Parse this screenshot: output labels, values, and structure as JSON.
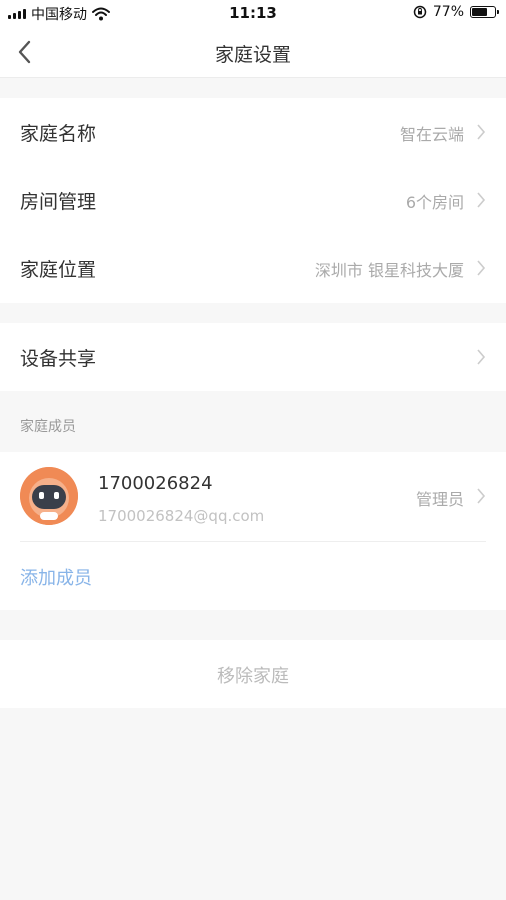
{
  "status_bar": {
    "carrier": "中国移动",
    "time": "11:13",
    "battery_percent": "77%",
    "battery_level": 0.77,
    "icons": [
      "signal-icon",
      "wifi-icon",
      "rotation-lock-icon",
      "battery-icon"
    ]
  },
  "nav": {
    "title": "家庭设置",
    "back_icon": "chevron-left-icon"
  },
  "settings": {
    "rows": [
      {
        "label": "家庭名称",
        "value": "智在云端"
      },
      {
        "label": "房间管理",
        "value": "6个房间"
      },
      {
        "label": "家庭位置",
        "value": "深圳市 银星科技大厦"
      }
    ],
    "share": {
      "label": "设备共享"
    }
  },
  "members": {
    "section_label": "家庭成员",
    "list": [
      {
        "name": "1700026824",
        "email": "1700026824@qq.com",
        "role": "管理员",
        "avatar_icon": "robot-avatar-icon"
      }
    ],
    "add_label": "添加成员"
  },
  "remove_label": "移除家庭",
  "colors": {
    "background": "#f7f7f7",
    "card": "#ffffff",
    "link": "#88b4e8",
    "muted": "#aaaaaa",
    "avatar": "#f08a55"
  }
}
